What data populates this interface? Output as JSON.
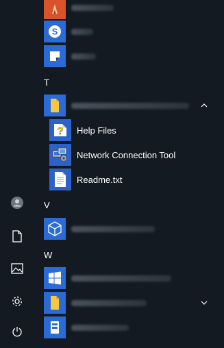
{
  "sections": [
    {
      "letter": "T"
    },
    {
      "letter": "V"
    },
    {
      "letter": "W"
    }
  ],
  "t_group": {
    "children": [
      {
        "label": "Help Files",
        "icon": "help-file-icon"
      },
      {
        "label": "Network Connection Tool",
        "icon": "network-tool-icon"
      },
      {
        "label": "Readme.txt",
        "icon": "text-document-icon"
      }
    ]
  },
  "rail": {
    "icons": [
      "user-account-icon",
      "documents-icon",
      "pictures-icon",
      "settings-icon",
      "power-icon"
    ]
  },
  "colors": {
    "background": "#141a22",
    "tile_blue": "#2b6bd6",
    "tile_orange": "#d9542b"
  }
}
